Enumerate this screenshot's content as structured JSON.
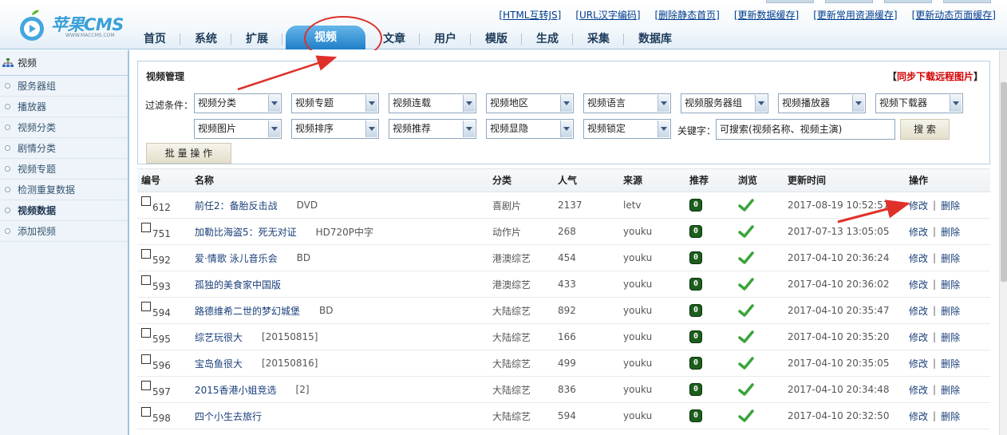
{
  "brand": {
    "name": "苹果CMS",
    "url": "WWW.MACCMS.COM"
  },
  "quick_links": [
    "[HTML互转JS]",
    "[URL汉字编码]",
    "[删除静态首页]",
    "[更新数据缓存]",
    "[更新常用资源缓存]",
    "[更新动态页面缓存]"
  ],
  "nav": [
    "首页",
    "系统",
    "扩展",
    "视频",
    "文章",
    "用户",
    "模版",
    "生成",
    "采集",
    "数据库"
  ],
  "sidebar": {
    "title": "视频",
    "items": [
      "服务器组",
      "播放器",
      "视频分类",
      "剧情分类",
      "视频专题",
      "检测重复数据",
      "视频数据",
      "添加视频"
    ]
  },
  "panel": {
    "title": "视频管理",
    "sync_prefix": "【",
    "sync_link": "同步下载远程图片",
    "sync_suffix": "】",
    "filter_label": "过滤条件：",
    "filters_row1": [
      "视频分类",
      "视频专题",
      "视频连载",
      "视频地区",
      "视频语言",
      "视频服务器组",
      "视频播放器",
      "视频下载器"
    ],
    "filters_row2": [
      "视频图片",
      "视频排序",
      "视频推荐",
      "视频显隐",
      "视频锁定"
    ],
    "keyword_label": "关键字：",
    "keyword_value": "可搜索(视频名称、视频主演)",
    "search_button": "搜 索",
    "batch_button": "批 量 操 作"
  },
  "table": {
    "headers": [
      "编号",
      "名称",
      "分类",
      "人气",
      "来源",
      "推荐",
      "浏览",
      "更新时间",
      "操作"
    ],
    "rows": [
      {
        "id": "612",
        "name": "前任2：备胎反击战",
        "remark": "DVD",
        "category": "喜剧片",
        "hits": "2137",
        "source": "letv",
        "level": "0",
        "time": "2017-08-19 10:52:57"
      },
      {
        "id": "751",
        "name": "加勒比海盗5：死无对证",
        "remark": "HD720P中字",
        "category": "动作片",
        "hits": "268",
        "source": "youku",
        "level": "0",
        "time": "2017-07-13 13:05:05"
      },
      {
        "id": "592",
        "name": "爱·情歌 泳儿音乐会",
        "remark": "BD",
        "category": "港澳综艺",
        "hits": "454",
        "source": "youku",
        "level": "0",
        "time": "2017-04-10 20:36:24"
      },
      {
        "id": "593",
        "name": "孤独的美食家中国版",
        "remark": "",
        "category": "港澳综艺",
        "hits": "433",
        "source": "youku",
        "level": "0",
        "time": "2017-04-10 20:36:02"
      },
      {
        "id": "594",
        "name": "路德维希二世的梦幻城堡",
        "remark": "BD",
        "category": "大陆综艺",
        "hits": "892",
        "source": "youku",
        "level": "0",
        "time": "2017-04-10 20:35:47"
      },
      {
        "id": "595",
        "name": "综艺玩很大",
        "remark": "[20150815]",
        "category": "大陆综艺",
        "hits": "166",
        "source": "youku",
        "level": "0",
        "time": "2017-04-10 20:35:20"
      },
      {
        "id": "596",
        "name": "宝岛鱼很大",
        "remark": "[20150816]",
        "category": "大陆综艺",
        "hits": "499",
        "source": "youku",
        "level": "0",
        "time": "2017-04-10 20:35:05"
      },
      {
        "id": "597",
        "name": "2015香港小姐竞选",
        "remark": "[2]",
        "category": "大陆综艺",
        "hits": "836",
        "source": "youku",
        "level": "0",
        "time": "2017-04-10 20:34:48"
      },
      {
        "id": "598",
        "name": "四个小生去旅行",
        "remark": "",
        "category": "大陆综艺",
        "hits": "594",
        "source": "youku",
        "level": "0",
        "time": "2017-04-10 20:32:50"
      }
    ],
    "edit_label": "修改",
    "op_separator": "|",
    "delete_label": "删除"
  },
  "colors": {
    "annotation": "#e0302a",
    "accent": "#1f7fc8",
    "sync_link": "#d40000"
  }
}
